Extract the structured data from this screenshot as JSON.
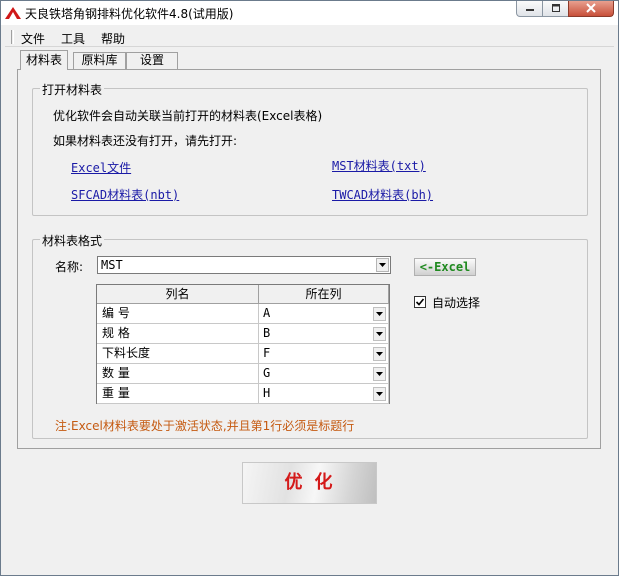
{
  "window": {
    "title": "天良铁塔角钢排料优化软件4.8(试用版)"
  },
  "menu": [
    "文件",
    "工具",
    "帮助"
  ],
  "tabs": [
    {
      "label": "材料表",
      "active": true
    },
    {
      "label": "原料库",
      "active": false
    },
    {
      "label": "设置",
      "active": false
    }
  ],
  "open_group": {
    "title": "打开材料表",
    "line1": "优化软件会自动关联当前打开的材料表(Excel表格)",
    "line2": "如果材料表还没有打开，请先打开:",
    "links": [
      "Excel文件",
      "MST材料表(txt)",
      "SFCAD材料表(nbt)",
      "TWCAD材料表(bh)"
    ]
  },
  "format_group": {
    "title": "材料表格式",
    "name_label": "名称:",
    "name_value": "MST",
    "excel_button": "<-Excel",
    "auto_select_label": "自动选择",
    "auto_select_checked": true,
    "columns_header": [
      "列名",
      "所在列"
    ],
    "rows": [
      {
        "name": "编  号",
        "col": "A"
      },
      {
        "name": "规  格",
        "col": "B"
      },
      {
        "name": "下料长度",
        "col": "F"
      },
      {
        "name": "数  量",
        "col": "G"
      },
      {
        "name": "重  量",
        "col": "H"
      }
    ],
    "note": "注:Excel材料表要处于激活状态,并且第1行必须是标题行"
  },
  "optimize_button": "优化",
  "colors": {
    "link": "#1a1aa6",
    "note": "#c55a11",
    "excel_button": "#1f8a1f",
    "optimize_button": "#d41a1a"
  },
  "icons": [
    "app-logo-icon",
    "minimize-icon",
    "maximize-icon",
    "close-icon",
    "dropdown-arrow-icon",
    "checkmark-icon"
  ]
}
